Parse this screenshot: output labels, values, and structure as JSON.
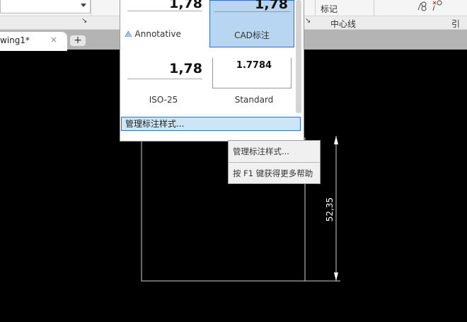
{
  "ribbon": {
    "marking_label": "标记",
    "centerline_label": "中心线",
    "leader_label": "引线",
    "expander": "↘"
  },
  "tabs": {
    "doc_tab": "wing1*",
    "close": "×",
    "new_tab": "+"
  },
  "dim_styles": [
    {
      "name": "Annotative",
      "preview": "1,78"
    },
    {
      "name": "CAD标注",
      "preview": "1,78",
      "selected": true
    },
    {
      "name": "ISO-25",
      "preview": "1,78"
    },
    {
      "name": "Standard",
      "preview": "1.7784"
    }
  ],
  "manage_button": "管理标注样式...",
  "context_menu": {
    "item1": "管理标注样式...",
    "item2": "按 F1 键获得更多帮助"
  },
  "drawing": {
    "dimension_text": "52,35"
  }
}
